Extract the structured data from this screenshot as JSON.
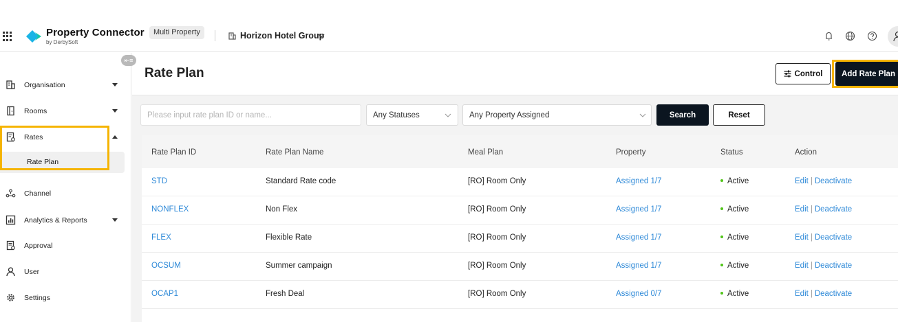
{
  "header": {
    "brand_title": "Property Connector",
    "brand_sub": "by DerbySoft",
    "mode_badge": "Multi Property",
    "hotel_group": "Horizon Hotel Group"
  },
  "sidebar": {
    "collapse_label": "⇤≡",
    "items": [
      {
        "label": "Organisation",
        "icon": "building-icon",
        "arrow": "down"
      },
      {
        "label": "Rooms",
        "icon": "door-icon",
        "arrow": "down"
      },
      {
        "label": "Rates",
        "icon": "rates-doc-icon",
        "arrow": "up"
      },
      {
        "label": "Channel",
        "icon": "channel-network-icon"
      },
      {
        "label": "Analytics & Reports",
        "icon": "analytics-icon",
        "arrow": "down"
      },
      {
        "label": "Approval",
        "icon": "approval-icon"
      },
      {
        "label": "User",
        "icon": "user-icon"
      },
      {
        "label": "Settings",
        "icon": "gear-icon"
      }
    ],
    "sub_item": "Rate Plan"
  },
  "page": {
    "title": "Rate Plan",
    "control_label": "Control",
    "add_label": "Add Rate Plan"
  },
  "filters": {
    "search_placeholder": "Please input rate plan ID or name...",
    "status_value": "Any Statuses",
    "property_value": "Any Property Assigned",
    "search_label": "Search",
    "reset_label": "Reset"
  },
  "table": {
    "headers": [
      "Rate Plan ID",
      "Rate Plan Name",
      "Meal Plan",
      "Property",
      "Status",
      "Action"
    ],
    "edit_label": "Edit",
    "sep": "|",
    "deactivate_label": "Deactivate",
    "rows": [
      {
        "id": "STD",
        "name": "Standard Rate code",
        "meal": "[RO] Room Only",
        "property": "Assigned 1/7",
        "status": "Active"
      },
      {
        "id": "NONFLEX",
        "name": "Non Flex",
        "meal": "[RO] Room Only",
        "property": "Assigned 1/7",
        "status": "Active"
      },
      {
        "id": "FLEX",
        "name": "Flexible Rate",
        "meal": "[RO] Room Only",
        "property": "Assigned 1/7",
        "status": "Active"
      },
      {
        "id": "OCSUM",
        "name": "Summer campaign",
        "meal": "[RO] Room Only",
        "property": "Assigned 1/7",
        "status": "Active"
      },
      {
        "id": "OCAP1",
        "name": "Fresh Deal",
        "meal": "[RO] Room Only",
        "property": "Assigned 0/7",
        "status": "Active"
      }
    ]
  },
  "colors": {
    "accent_link": "#2f8ad8",
    "primary_button": "#0b1520",
    "highlight": "#f5b400",
    "active_dot": "#52c41a",
    "brand_logo": "#1ab4e6"
  }
}
